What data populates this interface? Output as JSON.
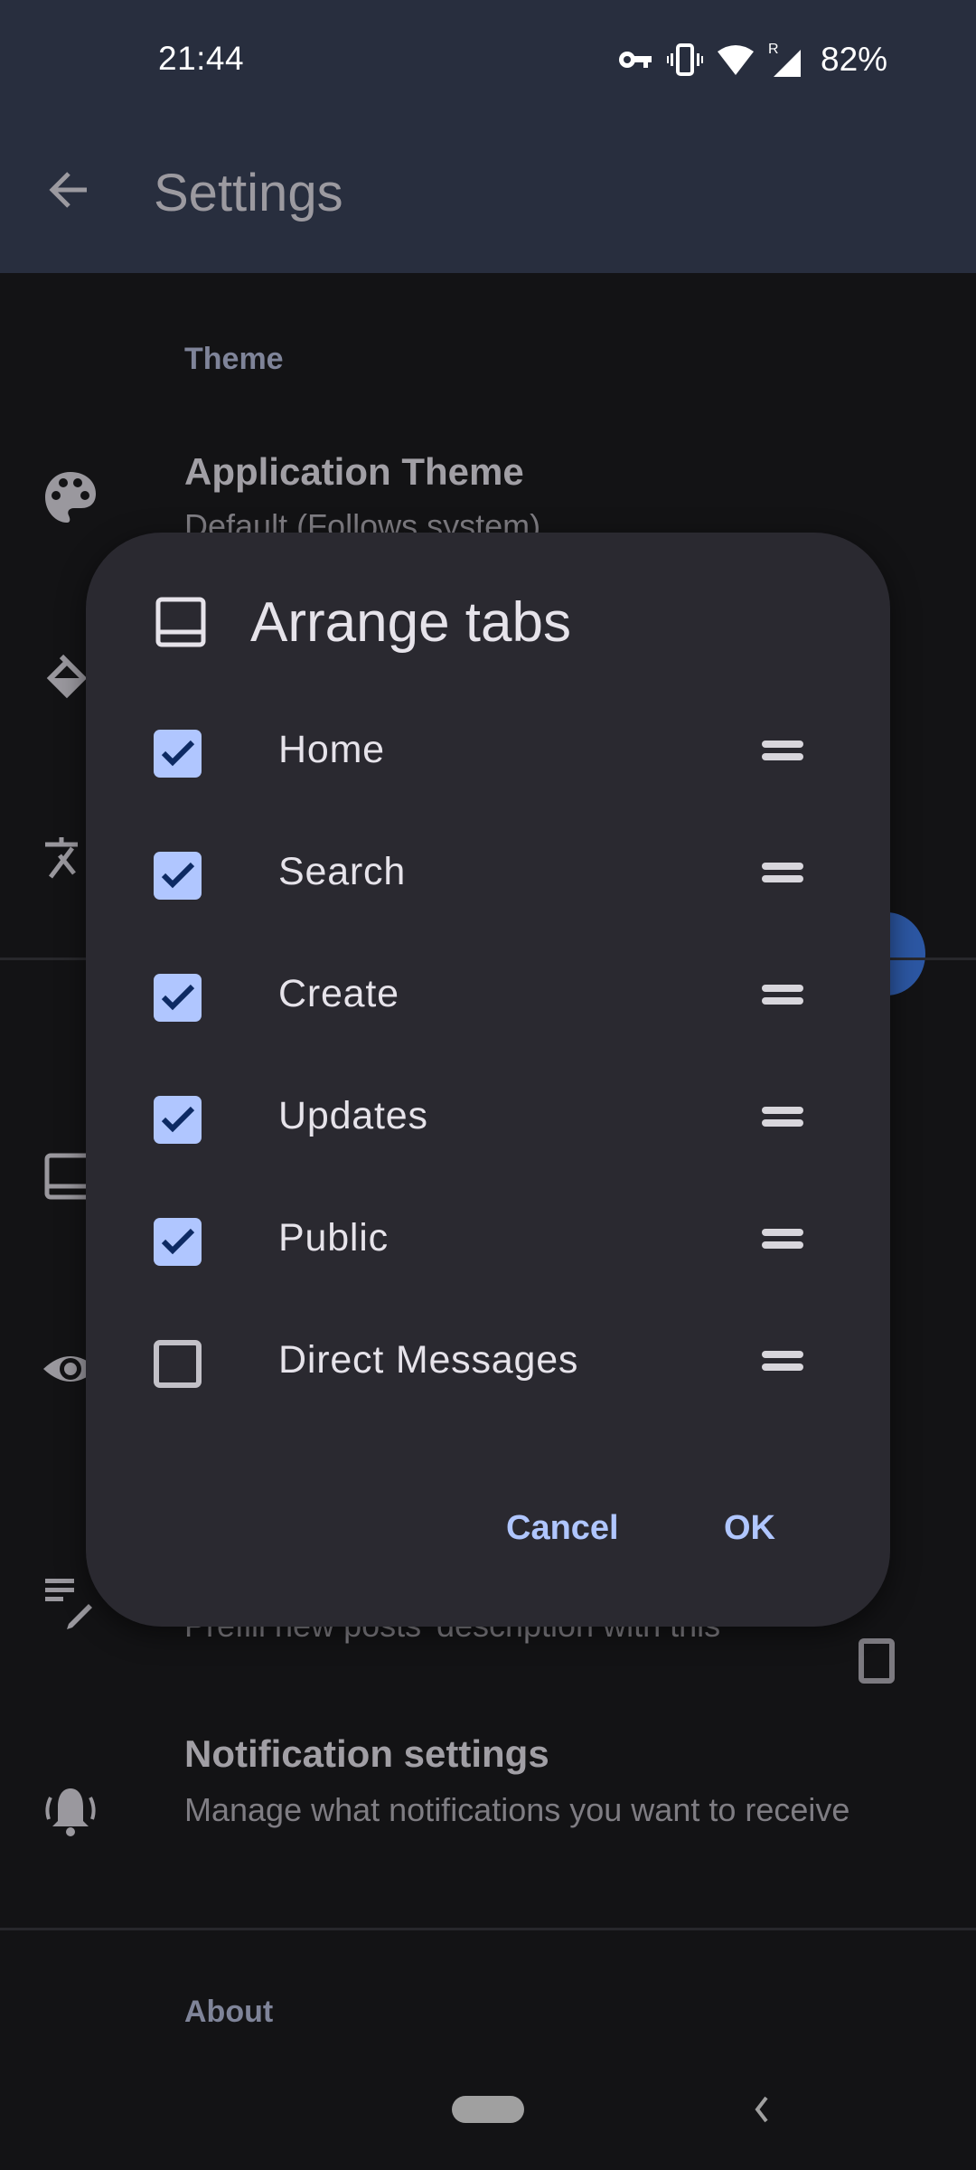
{
  "status_bar": {
    "time": "21:44",
    "icons": [
      "vpn-key-icon",
      "vibrate-icon",
      "wifi-icon",
      "signal-roaming-icon"
    ],
    "roaming_label": "R",
    "battery": "82%"
  },
  "app_bar": {
    "back_icon": "arrow-back-icon",
    "title": "Settings"
  },
  "background": {
    "theme_section": "Theme",
    "application_theme": {
      "title": "Application Theme",
      "summary": "Default (Follows system)",
      "icon": "palette-icon"
    },
    "color_item_icon": "paint-bucket-icon",
    "language_item_icon": "translate-icon",
    "tabs_item_icon": "tab-icon",
    "visibility_item_icon": "eye-icon",
    "prefill_item": {
      "icon": "edit-note-icon",
      "summary": "Prefill new posts' description with this"
    },
    "notification_settings": {
      "title": "Notification settings",
      "summary": "Manage what notifications you want to receive",
      "icon": "bell-ringing-icon"
    },
    "about_section": "About",
    "switch_accent": "#2c57a3"
  },
  "dialog": {
    "icon": "tab-icon",
    "title": "Arrange tabs",
    "tabs": [
      {
        "label": "Home",
        "checked": true
      },
      {
        "label": "Search",
        "checked": true
      },
      {
        "label": "Create",
        "checked": true
      },
      {
        "label": "Updates",
        "checked": true
      },
      {
        "label": "Public",
        "checked": true
      },
      {
        "label": "Direct Messages",
        "checked": false
      }
    ],
    "cancel_label": "Cancel",
    "ok_label": "OK",
    "accent_color": "#b0c6ff",
    "check_color": "#0d2a63"
  },
  "nav_bar": {
    "home": "home-pill",
    "back": "back-chevron-icon"
  }
}
